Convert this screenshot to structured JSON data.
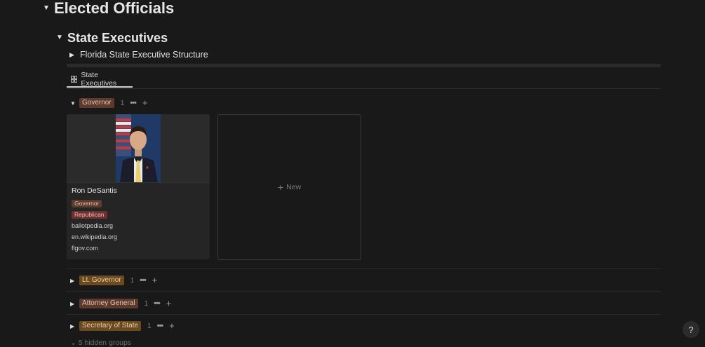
{
  "page": {
    "heading1": "Elected Officials",
    "heading2": "State Executives",
    "toggle_block": "Florida State Executive Structure"
  },
  "database": {
    "tab_label": "State Executives",
    "tab_icon": "gallery-icon",
    "groups": [
      {
        "label": "Governor",
        "count": "1",
        "color": "#5c3a2e",
        "text_color": "#e6c2b0",
        "expanded": true
      },
      {
        "label": "Lt. Governor",
        "count": "1",
        "color": "#6b4a1f",
        "text_color": "#ecd0a6",
        "expanded": false
      },
      {
        "label": "Attorney General",
        "count": "1",
        "color": "#5c3a2e",
        "text_color": "#e6c2b0",
        "expanded": false
      },
      {
        "label": "Secretary of State",
        "count": "1",
        "color": "#6b4a1f",
        "text_color": "#ecd0a6",
        "expanded": false
      }
    ],
    "card": {
      "title": "Ron DeSantis",
      "role": "Governor",
      "party": "Republican",
      "links": [
        "ballotpedia.org",
        "en.wikipedia.org",
        "flgov.com"
      ],
      "role_color": "#5c3a2e",
      "party_color": "#6e2f2f"
    },
    "new_label": "New",
    "hidden_groups": "5 hidden groups"
  },
  "help_label": "?"
}
